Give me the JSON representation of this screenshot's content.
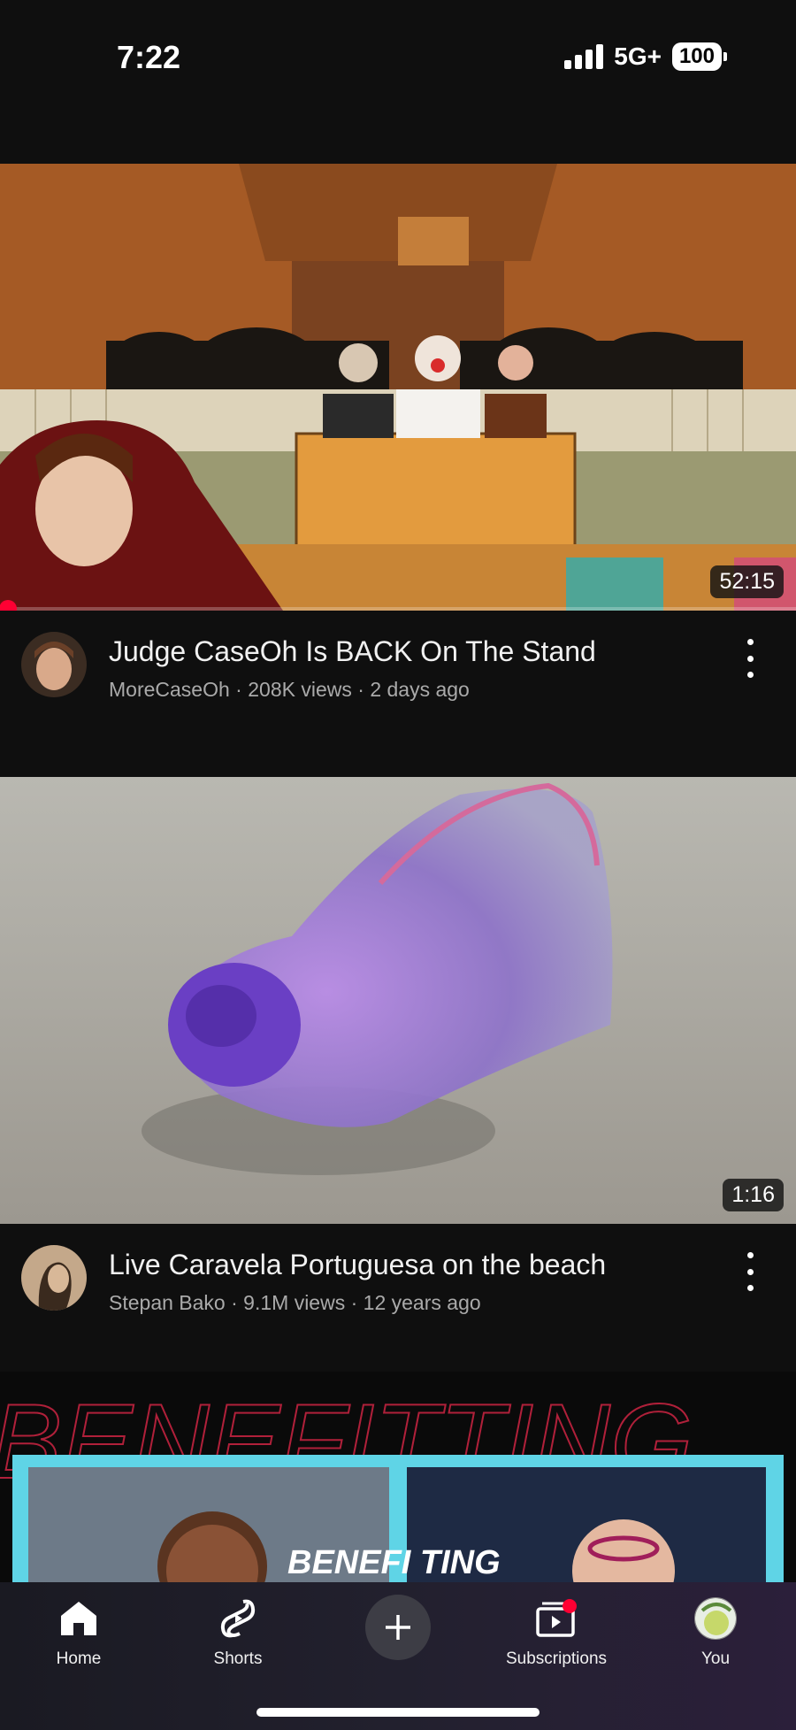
{
  "status_bar": {
    "time": "7:22",
    "network": "5G+",
    "battery": "100"
  },
  "videos": [
    {
      "title": "Judge CaseOh Is BACK On The Stand",
      "channel": "MoreCaseOh",
      "views": "208K views",
      "age": "2 days ago",
      "duration": "52:15",
      "watched_fraction": 0.01
    },
    {
      "title": "Live Caravela Portuguesa on the beach",
      "channel": "Stepan Bako",
      "views": "9.1M views",
      "age": "12 years ago",
      "duration": "1:16"
    },
    {
      "thumbnail_text": "BENEFI TING",
      "background_text": "BENEFITTING"
    }
  ],
  "meta_separator": " · ",
  "nav": {
    "home": "Home",
    "shorts": "Shorts",
    "subscriptions": "Subscriptions",
    "you": "You"
  },
  "colors": {
    "background": "#0f0f0f",
    "accent": "#ff0033",
    "secondary_text": "#aaaaaa"
  }
}
